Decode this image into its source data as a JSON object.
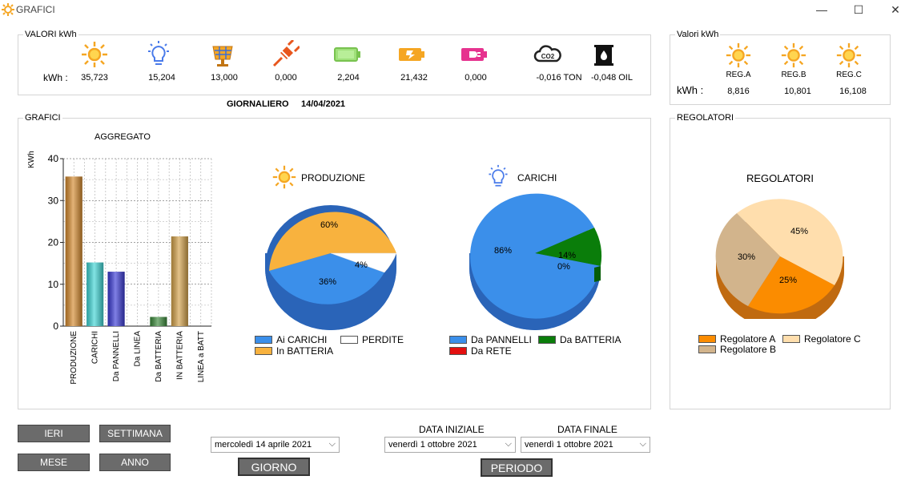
{
  "window": {
    "title": "GRAFICI",
    "minimize": "—",
    "maximize": "☐",
    "close": "✕"
  },
  "valori": {
    "title": "VALORI kWh",
    "unit_label": "kWh :",
    "items": [
      {
        "icon": "sun-icon",
        "value": "35,723"
      },
      {
        "icon": "bulb-icon",
        "value": "15,204"
      },
      {
        "icon": "solar-panel-icon",
        "value": "13,000"
      },
      {
        "icon": "plug-icon",
        "value": "0,000"
      },
      {
        "icon": "battery-full-icon",
        "value": "2,204"
      },
      {
        "icon": "battery-charging-icon",
        "value": "21,432"
      },
      {
        "icon": "battery-plug-icon",
        "value": "0,000"
      },
      {
        "icon": "co2-cloud-icon",
        "value": "-0,016 TON"
      },
      {
        "icon": "oil-barrel-icon",
        "value": "-0,048 OIL"
      }
    ]
  },
  "valori_reg": {
    "title": "Valori kWh",
    "unit_label": "kWh :",
    "items": [
      {
        "label": "REG.A",
        "value": "8,816"
      },
      {
        "label": "REG.B",
        "value": "10,801"
      },
      {
        "label": "REG.C",
        "value": "16,108"
      }
    ]
  },
  "period": {
    "label": "GIORNALIERO",
    "date": "14/04/2021"
  },
  "grafici": {
    "title": "GRAFICI",
    "bar_title": "AGGREGATO",
    "ylabel": "KWh",
    "yticks": [
      "40",
      "30",
      "20",
      "10",
      "0"
    ],
    "categories": [
      "PRODUZIONE",
      "CARICHI",
      "Da PANNELLI",
      "Da LINEA",
      "Da BATTERIA",
      "IN BATTERIA",
      "LINEA a BATT"
    ],
    "colors": [
      "#d58a2e",
      "#3fd6d6",
      "#3b3bd6",
      "#888888",
      "#3b8a3b",
      "#d4a24a",
      "#888888"
    ]
  },
  "produzione": {
    "title": "PRODUZIONE",
    "labels": [
      "60%",
      "36%",
      "4%"
    ],
    "legend": [
      "Ai CARICHI",
      "PERDITE",
      "In BATTERIA"
    ],
    "colors": {
      "carichi": "#3b8fea",
      "perdite": "#ffffff",
      "batteria": "#f8b23e"
    }
  },
  "carichi": {
    "title": "CARICHI",
    "labels": [
      "86%",
      "14%",
      "0%"
    ],
    "legend": [
      "Da PANNELLI",
      "Da BATTERIA",
      "Da RETE"
    ],
    "colors": {
      "pannelli": "#3b8fea",
      "batteria": "#0a7d0a",
      "rete": "#e31010"
    }
  },
  "regolatori": {
    "group_title": "REGOLATORI",
    "title": "REGOLATORI",
    "labels": [
      "45%",
      "30%",
      "25%"
    ],
    "legend": [
      "Regolatore A",
      "Regolatore C",
      "Regolatore B"
    ],
    "colors": {
      "a": "#fb8c00",
      "b": "#d2b48c",
      "c": "#ffdead"
    }
  },
  "buttons": {
    "ieri": "IERI",
    "settimana": "SETTIMANA",
    "mese": "MESE",
    "anno": "ANNO",
    "giorno": "GIORNO",
    "periodo": "PERIODO"
  },
  "dates": {
    "giorno": "mercoledì 14   aprile   2021",
    "iniziale_label": "DATA INIZIALE",
    "finale_label": "DATA FINALE",
    "iniziale": "venerdì    1  ottobre   2021",
    "finale": "venerdì    1  ottobre   2021"
  },
  "chart_data": {
    "type": "bar",
    "title": "AGGREGATO",
    "ylabel": "KWh",
    "categories": [
      "PRODUZIONE",
      "CARICHI",
      "Da PANNELLI",
      "Da LINEA",
      "Da BATTERIA",
      "IN BATTERIA",
      "LINEA a BATT"
    ],
    "values": [
      35.723,
      15.204,
      13.0,
      0.0,
      2.204,
      21.432,
      0.0
    ],
    "ylim": [
      0,
      40
    ],
    "grid": true
  }
}
